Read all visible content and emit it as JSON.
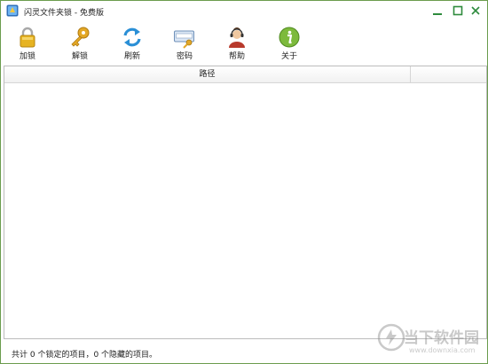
{
  "window": {
    "title": "闪灵文件夹锁 - 免费版"
  },
  "toolbar": {
    "lock": "加锁",
    "unlock": "解锁",
    "refresh": "刷新",
    "password": "密码",
    "help": "帮助",
    "about": "关于"
  },
  "list": {
    "columns": [
      "路径",
      ""
    ],
    "rows": []
  },
  "status": {
    "text": "共计 0 个锁定的项目，0 个隐藏的项目。"
  },
  "watermark": {
    "main": "当下软件园",
    "sub": "www.downxia.com"
  },
  "colors": {
    "window_border": "#6b9c4e",
    "win_controls": "#2e8b3d"
  }
}
